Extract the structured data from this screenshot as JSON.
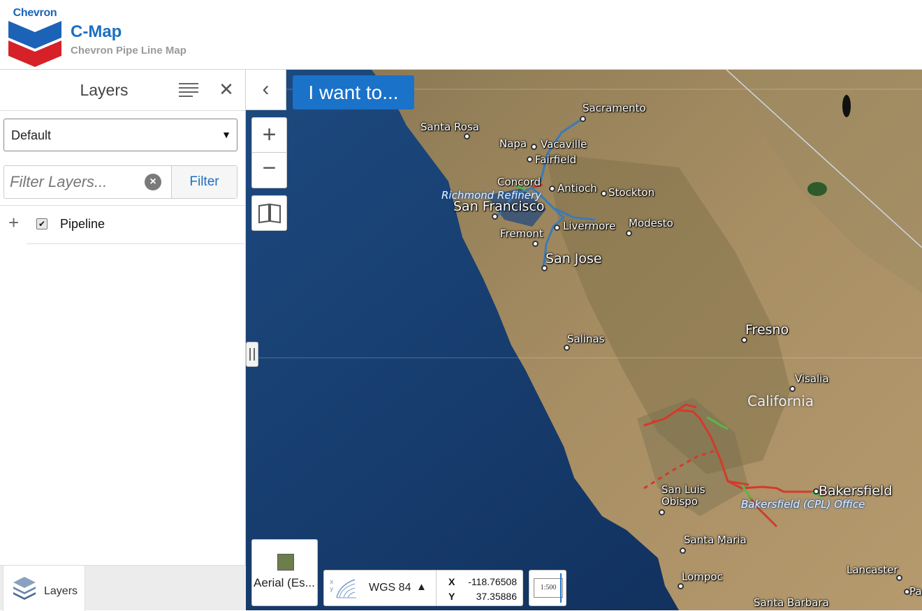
{
  "header": {
    "logo_text": "Chevron",
    "title": "C-Map",
    "subtitle": "Chevron Pipe Line Map"
  },
  "panel": {
    "title": "Layers",
    "menu_icon": "hamburger-menu-icon",
    "close_icon": "close-icon",
    "theme_select": {
      "value": "Default"
    },
    "filter": {
      "placeholder": "Filter Layers...",
      "value": "",
      "button_label": "Filter"
    },
    "layers": [
      {
        "label": "Pipeline",
        "checked": true
      }
    ],
    "bottom_tab": {
      "label": "Layers",
      "icon": "layers-stack-icon"
    }
  },
  "map": {
    "i_want_to_label": "I want to...",
    "collapse_icon": "chevron-left-icon",
    "zoom_in_icon": "plus-icon",
    "zoom_out_icon": "minus-icon",
    "bookmark_icon": "book-icon",
    "basemap_label": "Aerial (Es...",
    "coordinates": {
      "system": "WGS 84",
      "x_label": "X",
      "y_label": "Y",
      "x": "-118.76508",
      "y": "37.35886"
    },
    "scale_icon_text": "1:500",
    "cities": [
      "Sacramento",
      "Santa Rosa",
      "Napa",
      "Vacaville",
      "Fairfield",
      "Concord",
      "Antioch",
      "Stockton",
      "San Francisco",
      "Fremont",
      "Livermore",
      "Modesto",
      "San Jose",
      "Salinas",
      "Fresno",
      "Visalia",
      "San Luis Obispo",
      "Santa Maria",
      "Bakersfield",
      "Lompoc",
      "Lancaster",
      "Santa Barbara",
      "Pa"
    ],
    "state_label": "California",
    "poi_labels": [
      "Richmond Refinery",
      "Bakersfield (CPL) Office"
    ],
    "colors": {
      "pipeline_blue": "#3b7ab8",
      "pipeline_red": "#d33a2c",
      "pipeline_green": "#58b845",
      "brand_blue": "#1a72c9"
    }
  }
}
